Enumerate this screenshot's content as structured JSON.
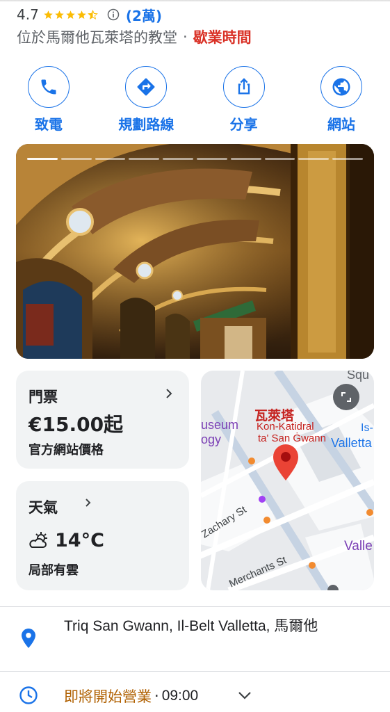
{
  "header": {
    "rating": "4.7",
    "stars": 4.5,
    "review_count": "(2萬)",
    "category": "位於馬爾他瓦萊塔的教堂",
    "separator": "·",
    "hours_link": "歇業時間"
  },
  "actions": [
    {
      "label": "致電",
      "icon": "phone-icon"
    },
    {
      "label": "規劃路線",
      "icon": "directions-icon"
    },
    {
      "label": "分享",
      "icon": "share-icon"
    },
    {
      "label": "網站",
      "icon": "globe-icon"
    }
  ],
  "photo": {
    "slides": 10,
    "active_slide": 1
  },
  "ticket": {
    "title": "門票",
    "price": "€15.00起",
    "note": "官方網站價格"
  },
  "weather": {
    "title": "天氣",
    "temperature": "14°C",
    "condition": "局部有雲",
    "icon": "partly-cloudy-icon"
  },
  "map": {
    "place_name_zh": "瓦萊塔",
    "place_name_1": "Kon-Katidral",
    "place_name_2": "ta' San Ġwann",
    "label_museum": "useum",
    "label_ogy": "ogy",
    "label_valletta": "Valletta",
    "label_is": "Is-",
    "label_valle": "Valle",
    "label_squ": "Squ",
    "street_zachary": "Zachary St",
    "street_merchants": "Merchants St"
  },
  "address": {
    "text": "Triq San Gwann, Il-Belt Valletta, 馬爾他"
  },
  "hours": {
    "status": "即將開始營業",
    "separator": "·",
    "time": "09:00"
  },
  "colors": {
    "accent": "#1a73e8",
    "closed": "#d93025",
    "opening_soon": "#b06000",
    "card_bg": "#f1f3f4"
  }
}
